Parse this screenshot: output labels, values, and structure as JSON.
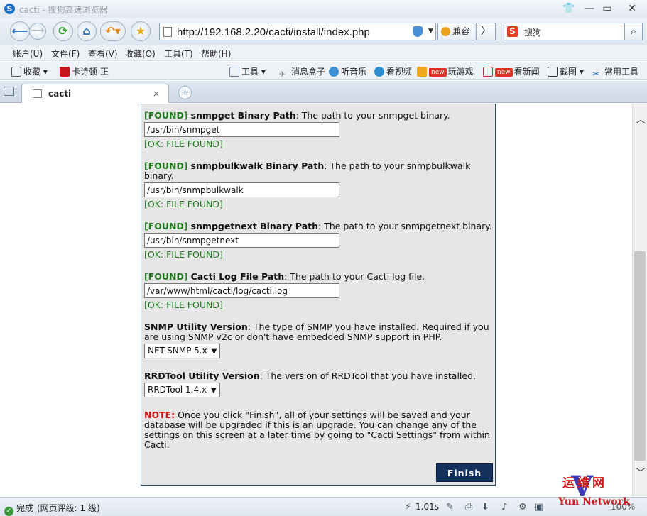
{
  "window": {
    "title": "cacti - 搜狗高速浏览器",
    "buttons": [
      "👕",
      "▭",
      "✕"
    ]
  },
  "nav": {
    "url": "http://192.168.2.20/cacti/install/index.php",
    "compat_label": "兼容",
    "search_placeholder": "搜狗"
  },
  "menu": [
    "账户(U)",
    "文件(F)",
    "查看(V)",
    "收藏(O)",
    "工具(T)",
    "帮助(H)"
  ],
  "toolbar": {
    "favorites": "收藏",
    "bookmark1": "卡诗顿 正",
    "tools": "工具",
    "msgbox": "消息盒子",
    "music": "听音乐",
    "video": "看视频",
    "games": "玩游戏",
    "news": "看新闻",
    "screenshot": "截图",
    "common_tools": "常用工具",
    "new_badge": "new"
  },
  "tab": {
    "label": "cacti",
    "close": "×"
  },
  "install": {
    "found_tag": "[FOUND]",
    "ok_text": "[OK: FILE FOUND]",
    "items": [
      {
        "name": "snmpget Binary Path",
        "desc": ": The path to your snmpget binary.",
        "value": "/usr/bin/snmpget"
      },
      {
        "name": "snmpbulkwalk Binary Path",
        "desc": ": The path to your snmpbulkwalk binary.",
        "value": "/usr/bin/snmpbulkwalk"
      },
      {
        "name": "snmpgetnext Binary Path",
        "desc": ": The path to your snmpgetnext binary.",
        "value": "/usr/bin/snmpgetnext"
      },
      {
        "name": "Cacti Log File Path",
        "desc": ": The path to your Cacti log file.",
        "value": "/var/www/html/cacti/log/cacti.log"
      }
    ],
    "snmp_version": {
      "name": "SNMP Utility Version",
      "desc": ": The type of SNMP you have installed. Required if you are using SNMP v2c or don't have embedded SNMP support in PHP.",
      "selected": "NET-SNMP 5.x"
    },
    "rrd_version": {
      "name": "RRDTool Utility Version",
      "desc": ": The version of RRDTool that you have installed.",
      "selected": "RRDTool 1.4.x"
    },
    "note_label": "NOTE:",
    "note_text": " Once you click \"Finish\", all of your settings will be saved and your database will be upgraded if this is an upgrade. You can change any of the settings on this screen at a later time by going to \"Cacti Settings\" from within Cacti.",
    "finish_label": "Finish"
  },
  "status": {
    "done": "完成",
    "rating": "(网页评级: 1 级)",
    "speed": "1.01s",
    "zoom": "100%"
  },
  "watermark": {
    "cn": "运维网",
    "v": "V",
    "en": "Yun Network"
  },
  "colors": {
    "found": "#1d7a1d",
    "note": "#cc1111",
    "finish_bg": "#15315e",
    "panel_bg": "#e6e6e6"
  }
}
